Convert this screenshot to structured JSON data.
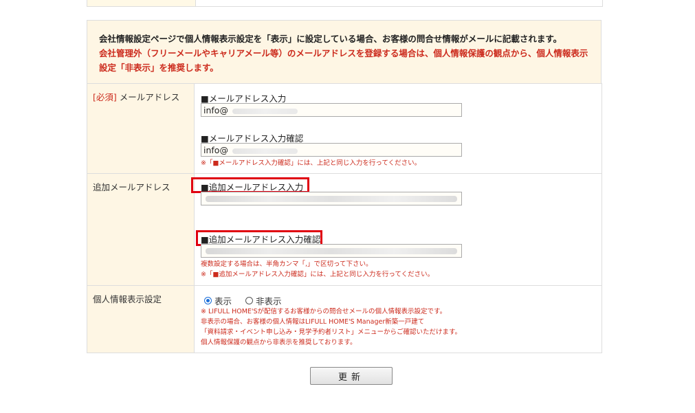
{
  "notice": {
    "line1": "会社情報設定ページで個人情報表示設定を「表示」に設定している場合、お客様の問合せ情報がメールに記載されます。",
    "line2": "会社管理外（フリーメールやキャリアメール等）のメールアドレスを登録する場合は、個人情報保護の観点から、個人情報表示設定「非表示」を推奨します。"
  },
  "email": {
    "required_tag": "[必須]",
    "label": "メールアドレス",
    "input_label": "■メールアドレス入力",
    "input_value": "info@",
    "confirm_label": "■メールアドレス入力確認",
    "confirm_value": "info@",
    "note": "※「■メールアドレス入力確認」には、上記と同じ入力を行ってください。"
  },
  "additional_email": {
    "label": "追加メールアドレス",
    "input_label": "■追加メールアドレス入力",
    "confirm_label": "■追加メールアドレス入力確認",
    "note1": "複数設定する場合は、半角カンマ「,」で区切って下さい。",
    "note2": "※「■追加メールアドレス入力確認」には、上記と同じ入力を行ってください。",
    "highlight_color": "#e00010"
  },
  "privacy": {
    "label": "個人情報表示設定",
    "option_show": "表示",
    "option_hide": "非表示",
    "selected": "表示",
    "notes": [
      "※ LIFULL HOME'Sが配信するお客様からの問合せメールの個人情報表示設定です。",
      "非表示の場合、お客様の個人情報はLIFULL HOME'S Manager新築一戸建て",
      "「資料請求・イベント申し込み・見学予約者リスト」メニューからご確認いただけます。",
      "個人情報保護の観点から非表示を推奨しております。"
    ]
  },
  "submit_label": "更新",
  "colors": {
    "label_bg": "#fef6e4",
    "accent_red": "#cc2b1d",
    "border": "#dddddd"
  }
}
